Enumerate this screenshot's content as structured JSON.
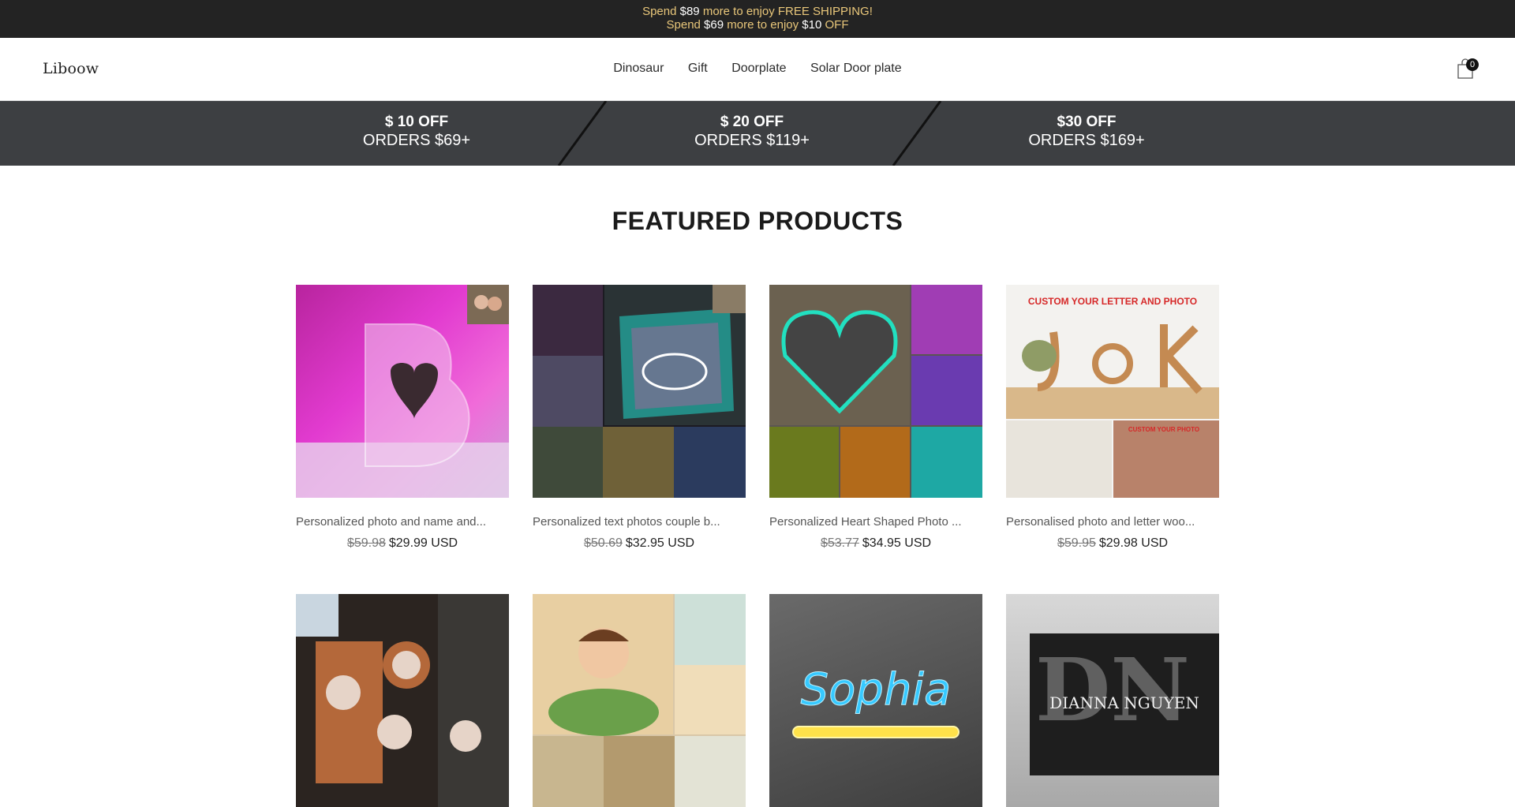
{
  "announcement": {
    "line1": {
      "pre": "Spend ",
      "amount": "$89",
      "post": " more to enjoy FREE SHIPPING!"
    },
    "line2": {
      "pre": "Spend ",
      "amount": "$69",
      "mid": " more to enjoy ",
      "amount2": "$10",
      "post": " OFF"
    }
  },
  "header": {
    "logo": "Liboow",
    "nav": [
      "Dinosaur",
      "Gift",
      "Doorplate",
      "Solar Door plate"
    ],
    "cart_count": "0"
  },
  "promos": [
    {
      "line1": "$ 10 OFF",
      "line2": "ORDERS $69+"
    },
    {
      "line1": "$ 20 OFF",
      "line2": "ORDERS $119+"
    },
    {
      "line1": "$30 OFF",
      "line2": "ORDERS $169+"
    }
  ],
  "section_title": "FEATURED PRODUCTS",
  "products": [
    {
      "title": "Personalized photo and name and...",
      "old_price": "$59.98",
      "new_price": "$29.99 USD"
    },
    {
      "title": "Personalized text photos couple b...",
      "old_price": "$50.69",
      "new_price": "$32.95 USD"
    },
    {
      "title": "Personalized Heart Shaped Photo ...",
      "old_price": "$53.77",
      "new_price": "$34.95 USD"
    },
    {
      "title": "Personalised photo and letter woo...",
      "old_price": "$59.95",
      "new_price": "$29.98 USD"
    },
    {
      "title": "",
      "old_price": "",
      "new_price": ""
    },
    {
      "title": "",
      "old_price": "",
      "new_price": ""
    },
    {
      "title": "",
      "old_price": "",
      "new_price": ""
    },
    {
      "title": "",
      "old_price": "",
      "new_price": ""
    }
  ],
  "image_text": {
    "p3_banner": "CUSTOM YOUR LETTER AND PHOTO",
    "p3_small": "CUSTOM YOUR PHOTO",
    "p6_name": "Sophia",
    "p7_name": "DIANNA NGUYEN"
  },
  "colors": {
    "announce_bg": "#232323",
    "announce_text": "#e9c77a",
    "promo_bg": "#3d3f42",
    "badge_bg": "#111111"
  }
}
